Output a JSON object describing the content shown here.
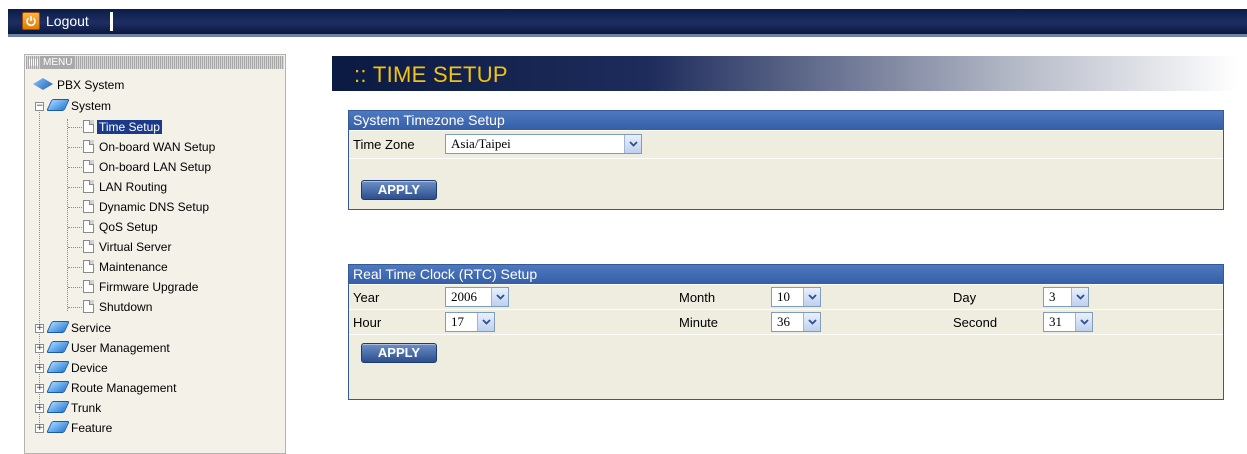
{
  "topbar": {
    "logout_label": "Logout",
    "power_icon": "power-icon"
  },
  "menu": {
    "header": "MENU",
    "root": "PBX System",
    "system": {
      "label": "System",
      "children": [
        "Time Setup",
        "On-board WAN Setup",
        "On-board LAN Setup",
        "LAN Routing",
        "Dynamic DNS Setup",
        "QoS Setup",
        "Virtual Server",
        "Maintenance",
        "Firmware Upgrade",
        "Shutdown"
      ],
      "selected": "Time Setup"
    },
    "groups": [
      "Service",
      "User Management",
      "Device",
      "Route Management",
      "Trunk",
      "Feature"
    ]
  },
  "page": {
    "title": ":: TIME SETUP"
  },
  "timezone": {
    "header": "System Timezone Setup",
    "label": "Time Zone",
    "value": "Asia/Taipei",
    "apply": "APPLY"
  },
  "rtc": {
    "header": "Real Time Clock (RTC) Setup",
    "year_label": "Year",
    "year": "2006",
    "month_label": "Month",
    "month": "10",
    "day_label": "Day",
    "day": "3",
    "hour_label": "Hour",
    "hour": "17",
    "minute_label": "Minute",
    "minute": "36",
    "second_label": "Second",
    "second": "31",
    "apply": "APPLY"
  }
}
